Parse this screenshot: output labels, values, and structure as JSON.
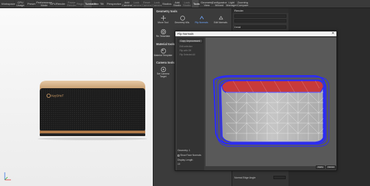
{
  "toolbar": {
    "items": [
      {
        "label": "Workspace",
        "state": "normal"
      },
      {
        "label": "CPU Usage",
        "state": "normal"
      },
      {
        "label": "Preset",
        "state": "normal"
      },
      {
        "label": "Performance Mode",
        "state": "normal"
      },
      {
        "label": "GPU",
        "state": "normal"
      },
      {
        "label": "Render",
        "state": "normal"
      },
      {
        "label": "Pause Render",
        "state": "dim"
      },
      {
        "label": "Region",
        "state": "dim"
      },
      {
        "label": "Turntable",
        "state": "active"
      },
      {
        "label": "Pan",
        "state": "normal"
      },
      {
        "label": "Tilt",
        "state": "normal"
      },
      {
        "label": "Perspective",
        "state": "normal"
      },
      {
        "label": "Add Camera",
        "state": "normal"
      },
      {
        "label": "Lock Camera",
        "state": "dim"
      },
      {
        "label": "Reset Camera",
        "state": "dim"
      },
      {
        "label": "Lock Camera",
        "state": "dim"
      },
      {
        "label": "Studios",
        "state": "normal"
      },
      {
        "label": "Add Studio",
        "state": "normal"
      },
      {
        "label": "Lock Studio",
        "state": "dim"
      },
      {
        "label": "Tools",
        "state": "active"
      },
      {
        "label": "Geometry View",
        "state": "normal"
      },
      {
        "label": "Configurator Wizard",
        "state": "normal"
      },
      {
        "label": "Light Manager",
        "state": "normal"
      },
      {
        "label": "Zooming Compare",
        "state": "normal"
      }
    ]
  },
  "viewport": {
    "logo_text": "KeySHoT"
  },
  "tools_panel": {
    "geometry_title": "Geometry tools",
    "geometry_tools": [
      {
        "label": "Move Tool",
        "icon": "move-icon",
        "selected": false
      },
      {
        "label": "Geometry Wiz.",
        "icon": "geometry-icon",
        "selected": false
      },
      {
        "label": "Flip Normals",
        "icon": "flip-normals-icon",
        "selected": true
      },
      {
        "label": "Edit Normals",
        "icon": "edit-normals-icon",
        "selected": false
      }
    ],
    "retessellate_label": "Re-Tessellate",
    "material_title": "Material tools",
    "material_template_label": "Material Template",
    "camera_title": "Camera tools",
    "camera_target_label": "Set Camera Target"
  },
  "right_panel": {
    "header": "Render",
    "section_label": "Detail",
    "normals_row": "Normals",
    "normal_edge_angle_label": "Normal Edge Angle"
  },
  "dialog": {
    "title": "Flip Normals",
    "close_symbol": "✕",
    "sidebar_button": "Copy Unprocessed",
    "fields": [
      "Edit selection",
      "Flip with Off",
      "Flip Selected All"
    ],
    "geometry_label": "Geometry: 1",
    "show_faces_label": "Show Face Normals",
    "display_normals_label": "Display Length",
    "display_value": "10",
    "apply_label": "Apply",
    "cancel_label": "Cancel"
  },
  "colors": {
    "selection_blue": "#2a2aff",
    "face_red": "#c83a3a",
    "accent_blue": "#6fa8ff"
  }
}
